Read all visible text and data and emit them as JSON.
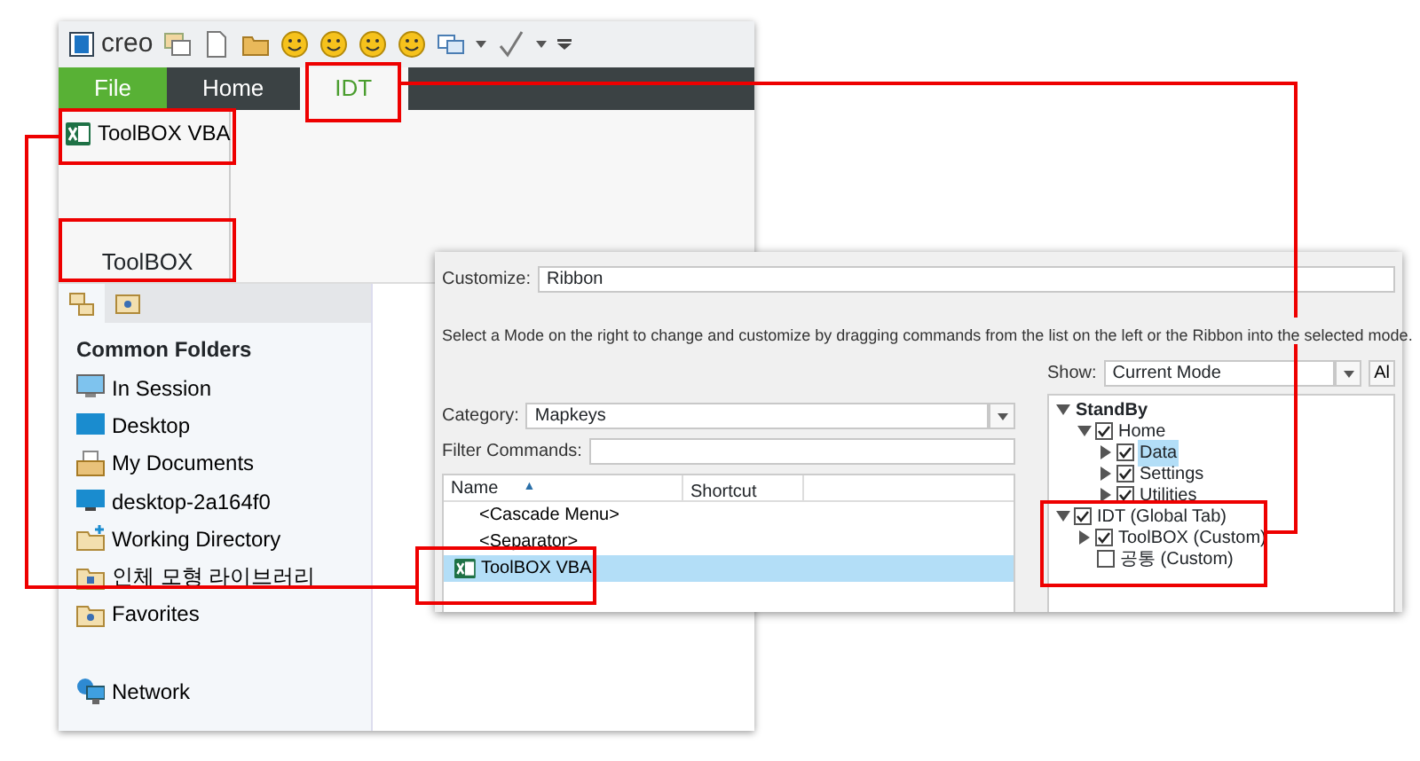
{
  "creo_window": {
    "logo": "creo",
    "tabs": [
      {
        "label": "File",
        "kind": "file",
        "selected": false
      },
      {
        "label": "Home",
        "kind": "ribbon",
        "selected": false
      },
      {
        "label": "IDT",
        "kind": "ribbon",
        "selected": true
      }
    ],
    "ribbon": {
      "buttons": [
        {
          "label": "ToolBOX VBA"
        }
      ],
      "group_label": "ToolBOX"
    },
    "navigator": {
      "heading": "Common Folders",
      "items": [
        {
          "label": "In Session",
          "kind": "session"
        },
        {
          "label": "Desktop",
          "kind": "desktop"
        },
        {
          "label": "My Documents",
          "kind": "documents"
        },
        {
          "label": "desktop-2a164f0",
          "kind": "computer"
        },
        {
          "label": "Working Directory",
          "kind": "workdir"
        },
        {
          "label": "인체 모형 라이브러리",
          "kind": "library"
        },
        {
          "label": "Favorites",
          "kind": "favorites"
        },
        {
          "label": "Network",
          "kind": "network"
        }
      ]
    }
  },
  "customize_dialog": {
    "customize": {
      "label": "Customize:",
      "value": "Ribbon"
    },
    "instructions": "Select a Mode on the right to change and customize by dragging commands from the list on the left or the Ribbon into the selected mode.",
    "category": {
      "label": "Category:",
      "value": "Mapkeys"
    },
    "filter": {
      "label": "Filter Commands:"
    },
    "commands": {
      "columns": [
        "Name",
        "Shortcut"
      ],
      "sort_indicator": "▲",
      "rows": [
        {
          "name": "<Cascade Menu>",
          "kind": "text",
          "selected": false
        },
        {
          "name": "<Separator>",
          "kind": "text",
          "selected": false
        },
        {
          "name": "ToolBOX VBA",
          "kind": "excel",
          "selected": true
        }
      ]
    },
    "show": {
      "label": "Show:",
      "value": "Current Mode"
    },
    "side_button": "Al",
    "tree": [
      {
        "label": "StandBy",
        "expanded": true,
        "selected": false,
        "children": [
          {
            "label": "Home",
            "checked": true,
            "expanded": true,
            "selected": false,
            "children": [
              {
                "label": "Data",
                "checked": true,
                "expanded": false,
                "selected": true
              },
              {
                "label": "Settings",
                "checked": true,
                "expanded": false,
                "selected": false
              },
              {
                "label": "Utilities",
                "checked": true,
                "expanded": false,
                "selected": false
              }
            ]
          }
        ]
      },
      {
        "label": "IDT (Global Tab)",
        "checked": true,
        "expanded": true,
        "selected": false,
        "children": [
          {
            "label": "ToolBOX (Custom)",
            "checked": true,
            "expanded": false,
            "selected": false
          },
          {
            "label": "공통 (Custom)",
            "checked": false,
            "selected": false
          }
        ]
      }
    ]
  }
}
